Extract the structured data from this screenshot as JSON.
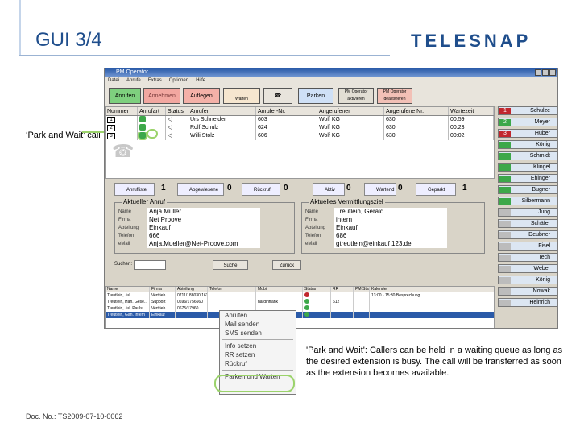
{
  "slide": {
    "title": "GUI 3/4",
    "logo": "TELESNAP",
    "park_label": "‘Park and Wait’ call",
    "caption": "'Park and Wait': Callers can be held in a waiting queue as long as the desired extension is busy. The call will be transferred as soon as the extension becomes available.",
    "doc_no": "Doc. No.: TS2009-07-10-0062"
  },
  "colors": {
    "accent": "#1f4e8c",
    "highlight": "#9bd36b",
    "green": "#3da84a",
    "red": "#c1272d"
  },
  "app": {
    "title": "PM Operator",
    "menu": [
      "Datei",
      "Anrufe",
      "Extras",
      "Optionen",
      "Hilfe"
    ],
    "toolbar": {
      "anrufen": "Anrufen",
      "annehmen": "Annehmen",
      "auflegen": "Auflegen",
      "holds": "Warten",
      "parken": "Parken",
      "pm1": "PM Operator aktivieren",
      "pm2": "PM Operator deaktivieren"
    },
    "grid": {
      "columns": [
        "Nummer",
        "Anrufart",
        "Status",
        "Anrufer",
        "Anrufer-Nr.",
        "Angerufener",
        "Angerufene Nr.",
        "Wartezeit"
      ],
      "rows": [
        {
          "num": "1",
          "caller": "Urs Schneider",
          "caller_nr": "603",
          "callee": "Wolf KG",
          "callee_nr": "630",
          "wait": "00:59"
        },
        {
          "num": "2",
          "caller": "Rolf Schulz",
          "caller_nr": "624",
          "callee": "Wolf KG",
          "callee_nr": "630",
          "wait": "00:23"
        },
        {
          "num": "3",
          "caller": "Willi Stolz",
          "caller_nr": "606",
          "callee": "Wolf KG",
          "callee_nr": "630",
          "wait": "00:02"
        }
      ]
    },
    "queues": [
      {
        "label": "Anrufliste",
        "count": "1"
      },
      {
        "label": "Abgewiesene",
        "count": "0"
      },
      {
        "label": "Rückruf",
        "count": "0"
      },
      {
        "label": "Aktiv",
        "count": "0"
      },
      {
        "label": "Wartend",
        "count": "0"
      },
      {
        "label": "Geparkt",
        "count": "1"
      }
    ],
    "current_call": {
      "legend": "Aktueller Anruf",
      "labels": [
        "Name",
        "Firma",
        "Abteilung",
        "Telefon",
        "eMail"
      ],
      "name": "Anja Müller",
      "firma": "Net Proove",
      "abteilung": "Einkauf",
      "telefon": "666",
      "email": "Anja.Mueller@Net-Proove.com"
    },
    "current_target": {
      "legend": "Aktuelles Vermittlungsziel",
      "labels": [
        "Name",
        "Firma",
        "Abteilung",
        "Telefon",
        "eMail"
      ],
      "name": "Treutlein, Gerald",
      "firma": "intern",
      "abteilung": "Einkauf",
      "telefon": "686",
      "email": "gtreutlein@einkauf 123.de"
    },
    "search": {
      "label": "Suchen:",
      "btn1": "Suche",
      "btn2": "Zurück"
    },
    "lower": {
      "columns": [
        "Name",
        "Firma",
        "Abteilung",
        "Telefon",
        "Mobil",
        "Status",
        "RR",
        "PM-Status",
        "Kalender"
      ],
      "rows": [
        {
          "name": "Treutlein, Jul.",
          "firma": "Vertrieb",
          "abt": "0711/188030 163",
          "tel": "",
          "mobil": "",
          "status": "red",
          "rr": "",
          "pm": "",
          "kal": "13:00 - 15:30 Besprechung"
        },
        {
          "name": "Treutlein, Han. Gese..",
          "firma": "Support",
          "abt": "0696/1756660",
          "tel": "",
          "mobil": "hardinfrank",
          "status": "green",
          "rr": "612",
          "pm": "",
          "kal": ""
        },
        {
          "name": "Treutlein, Jul. Pauls..",
          "firma": "Vertrieb",
          "abt": "0675/17960",
          "tel": "",
          "mobil": "",
          "status": "green",
          "rr": "",
          "pm": "",
          "kal": ""
        },
        {
          "name": "Treutlein, Gan. Intern",
          "firma": "Einkauf",
          "abt": "",
          "tel": "",
          "mobil": "",
          "status": "green",
          "rr": "",
          "pm": "",
          "kal": ""
        }
      ]
    },
    "users": [
      {
        "n": "1",
        "name": "Schulze",
        "color": "#c1272d"
      },
      {
        "n": "2",
        "name": "Meyer",
        "color": "#3da84a"
      },
      {
        "n": "3",
        "name": "Huber",
        "color": "#c1272d"
      },
      {
        "n": "",
        "name": "König",
        "color": "#3da84a"
      },
      {
        "n": "",
        "name": "Schmidt",
        "color": "#3da84a"
      },
      {
        "n": "",
        "name": "Klingel",
        "color": "#3da84a"
      },
      {
        "n": "",
        "name": "Ehinger",
        "color": "#3da84a"
      },
      {
        "n": "",
        "name": "Bugner",
        "color": "#3da84a"
      },
      {
        "n": "",
        "name": "Silbermann",
        "color": "#3da84a"
      },
      {
        "n": "",
        "name": "Jung",
        "color": "#bcbcbc"
      },
      {
        "n": "",
        "name": "Schäfer",
        "color": "#bcbcbc"
      },
      {
        "n": "",
        "name": "Deubner",
        "color": "#bcbcbc"
      },
      {
        "n": "",
        "name": "Fisel",
        "color": "#bcbcbc"
      },
      {
        "n": "",
        "name": "Tech",
        "color": "#bcbcbc"
      },
      {
        "n": "",
        "name": "Weber",
        "color": "#bcbcbc"
      },
      {
        "n": "",
        "name": "König",
        "color": "#bcbcbc"
      },
      {
        "n": "",
        "name": "Nowak",
        "color": "#bcbcbc"
      },
      {
        "n": "",
        "name": "Heinrich",
        "color": "#bcbcbc"
      }
    ],
    "context_menu": [
      "Anrufen",
      "Mail senden",
      "SMS senden",
      "",
      "Info setzen",
      "RR setzen",
      "Rückruf",
      "",
      "Parken und Warten"
    ]
  }
}
